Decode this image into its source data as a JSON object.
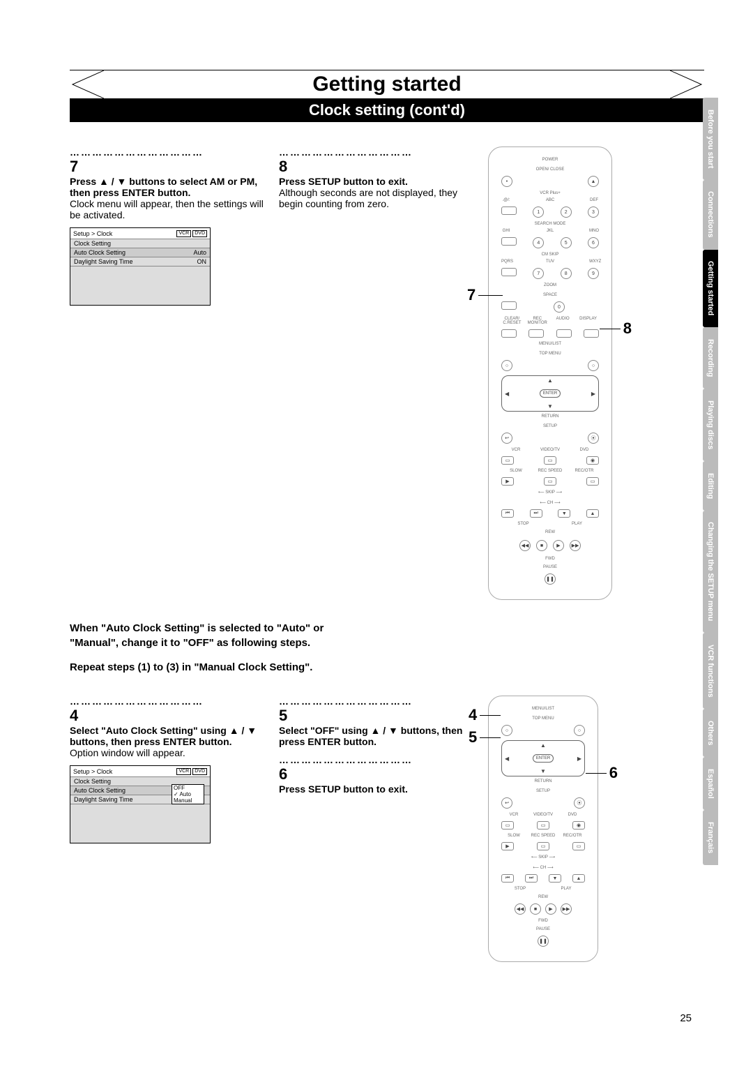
{
  "header": {
    "title": "Getting started",
    "subtitle": "Clock setting (cont'd)"
  },
  "side_tabs": [
    {
      "label": "Before you start",
      "key": "before"
    },
    {
      "label": "Connections",
      "key": "connections"
    },
    {
      "label": "Getting started",
      "key": "getting",
      "active": true
    },
    {
      "label": "Recording",
      "key": "recording"
    },
    {
      "label": "Playing discs",
      "key": "playing"
    },
    {
      "label": "Editing",
      "key": "editing"
    },
    {
      "label": "Changing the SETUP menu",
      "key": "setup"
    },
    {
      "label": "VCR functions",
      "key": "vcr"
    },
    {
      "label": "Others",
      "key": "others"
    },
    {
      "label": "Español",
      "key": "es"
    },
    {
      "label": "Français",
      "key": "fr"
    }
  ],
  "step7": {
    "num": "7",
    "bold": "Press ▲ / ▼ buttons to select AM or PM, then press ENTER button.",
    "body": "Clock menu will appear, then the settings will be activated."
  },
  "step8": {
    "num": "8",
    "bold": "Press SETUP button to exit.",
    "body": "Although seconds are not displayed, they begin counting from zero."
  },
  "osd1": {
    "breadcrumb": "Setup > Clock",
    "badge1": "VCR",
    "badge2": "DVD",
    "r1l": "Clock Setting",
    "r1r": "",
    "r2l": "Auto Clock Setting",
    "r2r": "Auto",
    "r3l": "Daylight Saving Time",
    "r3r": "ON"
  },
  "midtext": {
    "l1": "When \"Auto Clock Setting\" is selected to \"Auto\" or",
    "l2": "\"Manual\", change it to \"OFF\" as following steps.",
    "l3": "Repeat steps (1) to (3) in \"Manual Clock Setting\"."
  },
  "step4": {
    "num": "4",
    "bold": "Select \"Auto Clock Setting\" using ▲ / ▼ buttons, then press ENTER button.",
    "body": "Option window will appear."
  },
  "step5": {
    "num": "5",
    "bold": "Select \"OFF\" using ▲ / ▼ buttons, then press ENTER button."
  },
  "step6": {
    "num": "6",
    "bold": "Press SETUP button to exit."
  },
  "osd2": {
    "breadcrumb": "Setup > Clock",
    "badge1": "VCR",
    "badge2": "DVD",
    "r1l": "Clock Setting",
    "r1r": "",
    "r2l": "Auto Clock Setting",
    "opt1": "OFF",
    "opt2": "Auto",
    "opt3": "Manual",
    "r3l": "Daylight Saving Time"
  },
  "remote_labels": {
    "power": "POWER",
    "openclose": "OPEN/\nCLOSE",
    "eject": "▲",
    "nums": [
      "1",
      "2",
      "3",
      "4",
      "5",
      "6",
      "7",
      "8",
      "9",
      "0"
    ],
    "abc_row": [
      ".@/:",
      "ABC",
      "DEF",
      "GHI",
      "JKL",
      "MNO",
      "PQRS",
      "TUV",
      "WXYZ",
      "SPACE"
    ],
    "vcrplus": "VCR Plus+",
    "search": "SEARCH\nMODE",
    "cmskip": "CM SKIP",
    "zoom": "ZOOM",
    "clear": "CLEAR/\nC.RESET",
    "recmon": "REC\nMONITOR",
    "audio": "AUDIO",
    "display": "DISPLAY",
    "menulist": "MENU/LIST",
    "topmenu": "TOP MENU",
    "enter": "ENTER",
    "return": "RETURN",
    "setup": "SETUP",
    "vcr": "VCR",
    "videotv": "VIDEO/TV",
    "dvd": "DVD",
    "slow": "SLOW",
    "recspeed": "REC\nSPEED",
    "recotr": "REC/OTR",
    "skip": "SKIP",
    "ch": "CH",
    "stop": "STOP",
    "play": "PLAY",
    "rew": "REW",
    "fwd": "FWD",
    "pause": "PAUSE"
  },
  "callouts": {
    "c7": "7",
    "c8": "8",
    "c4": "4",
    "c5": "5",
    "c6": "6"
  },
  "page_number": "25",
  "dots": "………………………………"
}
